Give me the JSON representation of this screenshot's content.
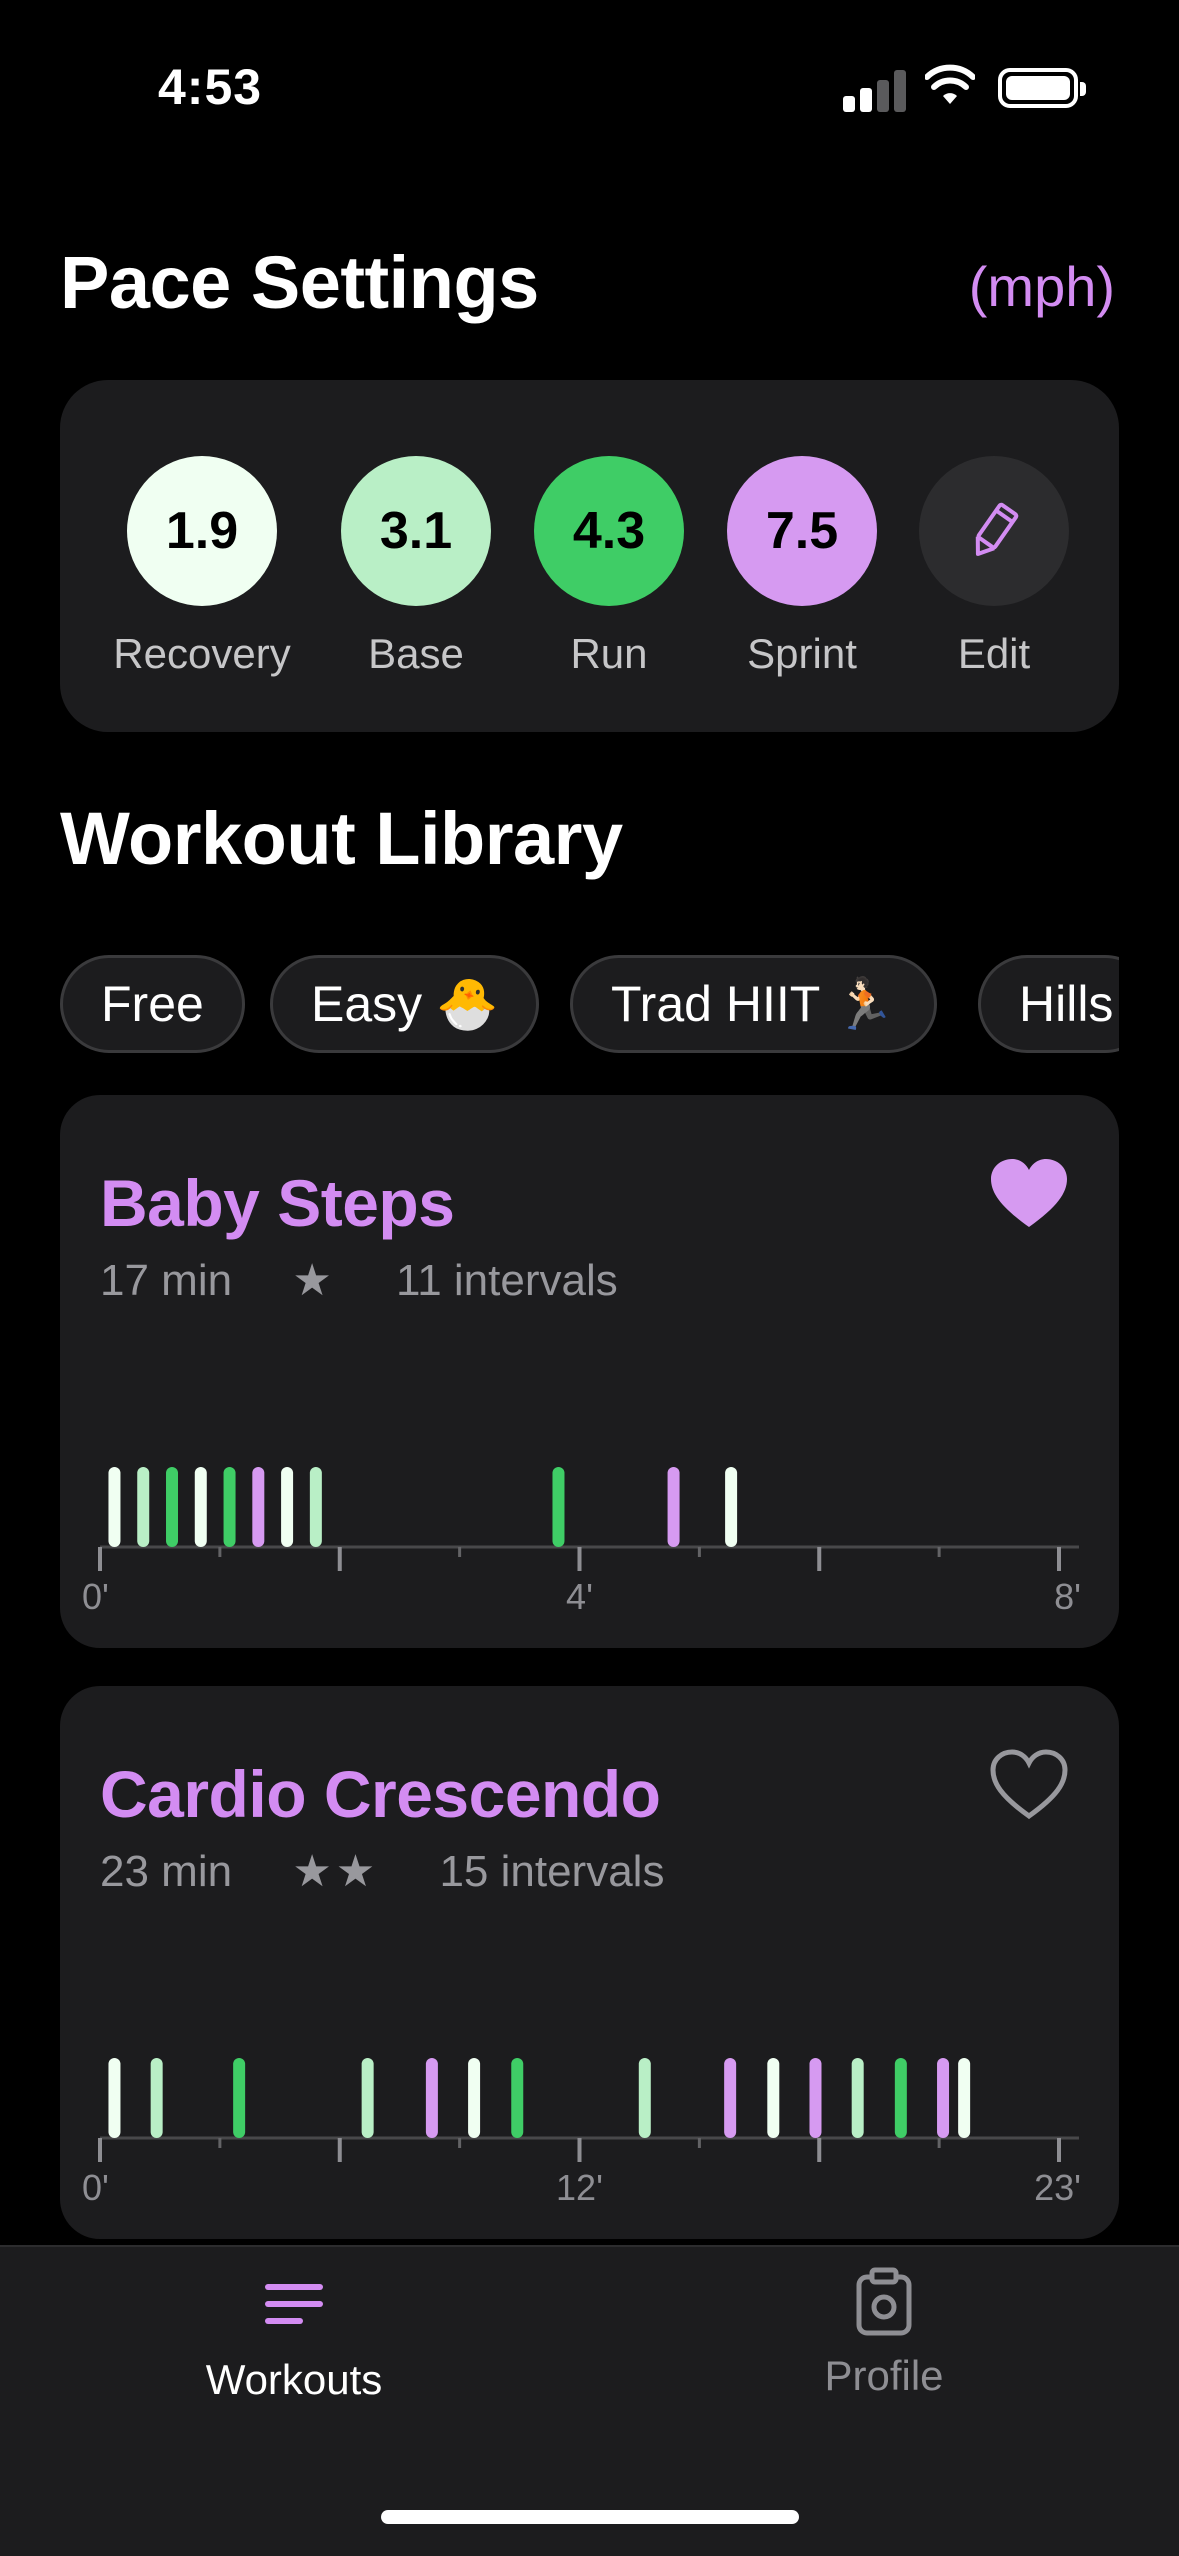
{
  "status_bar": {
    "time": "4:53"
  },
  "pace": {
    "title": "Pace Settings",
    "unit": "(mph)",
    "items": [
      {
        "value": "1.9",
        "label": "Recovery",
        "color": "#f0fff2"
      },
      {
        "value": "3.1",
        "label": "Base",
        "color": "#b9efc6"
      },
      {
        "value": "4.3",
        "label": "Run",
        "color": "#3fcd66"
      },
      {
        "value": "7.5",
        "label": "Sprint",
        "color": "#d69af1"
      }
    ],
    "edit": {
      "label": "Edit",
      "icon": "pencil-icon"
    }
  },
  "library": {
    "title": "Workout Library",
    "chips": [
      "Free",
      "Easy 🐣",
      "Trad HIIT 🏃🏻",
      "Hills"
    ]
  },
  "colors": {
    "recovery": "#f0fff2",
    "base": "#b9efc6",
    "run": "#3fcd66",
    "sprint": "#d69af1",
    "accent": "#d38cf2"
  },
  "workouts": [
    {
      "title": "Baby Steps",
      "duration": "17 min",
      "stars": "★",
      "intervals": "11 intervals",
      "favorite": true,
      "timeline": {
        "labels": [
          "0'",
          "4'",
          "8'"
        ],
        "bars": [
          {
            "pos": 0.013,
            "type": "recovery"
          },
          {
            "pos": 0.043,
            "type": "base"
          },
          {
            "pos": 0.073,
            "type": "run"
          },
          {
            "pos": 0.103,
            "type": "recovery"
          },
          {
            "pos": 0.133,
            "type": "run"
          },
          {
            "pos": 0.163,
            "type": "sprint"
          },
          {
            "pos": 0.193,
            "type": "recovery"
          },
          {
            "pos": 0.223,
            "type": "base"
          },
          {
            "pos": 0.476,
            "type": "run"
          },
          {
            "pos": 0.596,
            "type": "sprint"
          },
          {
            "pos": 0.656,
            "type": "recovery"
          }
        ]
      }
    },
    {
      "title": "Cardio Crescendo",
      "duration": "23 min",
      "stars": "★★",
      "intervals": "15 intervals",
      "favorite": false,
      "timeline": {
        "labels": [
          "0'",
          "12'",
          "23'"
        ],
        "bars": [
          {
            "pos": 0.013,
            "type": "recovery"
          },
          {
            "pos": 0.057,
            "type": "base"
          },
          {
            "pos": 0.143,
            "type": "run"
          },
          {
            "pos": 0.277,
            "type": "base"
          },
          {
            "pos": 0.344,
            "type": "sprint"
          },
          {
            "pos": 0.388,
            "type": "recovery"
          },
          {
            "pos": 0.433,
            "type": "run"
          },
          {
            "pos": 0.566,
            "type": "base"
          },
          {
            "pos": 0.655,
            "type": "sprint"
          },
          {
            "pos": 0.7,
            "type": "recovery"
          },
          {
            "pos": 0.744,
            "type": "sprint"
          },
          {
            "pos": 0.788,
            "type": "base"
          },
          {
            "pos": 0.833,
            "type": "run"
          },
          {
            "pos": 0.877,
            "type": "sprint"
          },
          {
            "pos": 0.899,
            "type": "recovery"
          }
        ]
      }
    }
  ],
  "tabs": [
    {
      "label": "Workouts",
      "icon": "list-icon",
      "active": true
    },
    {
      "label": "Profile",
      "icon": "clipboard-icon",
      "active": false
    }
  ]
}
